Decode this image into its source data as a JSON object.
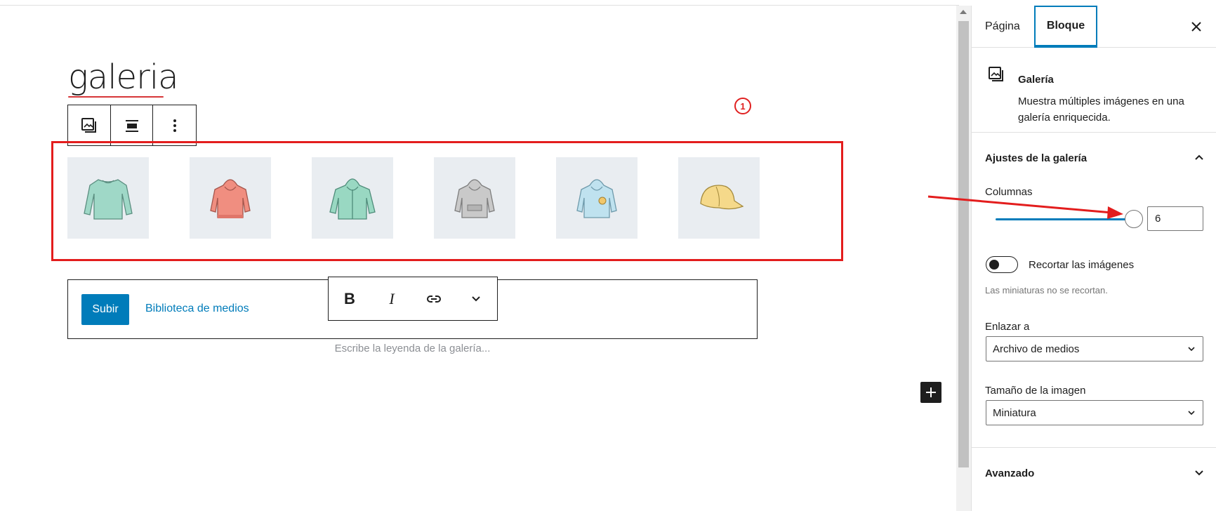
{
  "editor": {
    "post_title": "galeria",
    "annotation_number": "1",
    "gallery_items": [
      "sweater-mint",
      "hoodie-coral",
      "zip-hoodie-mint",
      "hoodie-grey",
      "hoodie-light-blue",
      "cap-yellow"
    ],
    "upload_button": "Subir",
    "media_library_link": "Biblioteca de medios",
    "caption_placeholder": "Escribe la leyenda de la galería...",
    "format_bold": "B",
    "format_italic": "I"
  },
  "sidebar": {
    "tabs": [
      {
        "label": "Página",
        "active": false
      },
      {
        "label": "Bloque",
        "active": true
      }
    ],
    "block": {
      "name": "Galería",
      "description": "Muestra múltiples imágenes en una galería enriquecida."
    },
    "gallery_settings": {
      "title": "Ajustes de la galería",
      "columns_label": "Columnas",
      "columns_value": "6",
      "columns_max": 8,
      "crop_label": "Recortar las imágenes",
      "crop_enabled": false,
      "crop_help": "Las miniaturas no se recortan.",
      "link_to_label": "Enlazar a",
      "link_to_value": "Archivo de medios",
      "image_size_label": "Tamaño de la imagen",
      "image_size_value": "Miniatura"
    },
    "advanced": {
      "title": "Avanzado"
    }
  },
  "colors": {
    "accent": "#007cba",
    "annotation": "#e31d1d",
    "title_underline": "#d63638",
    "thumbnail_bg": "#e9edf1"
  }
}
